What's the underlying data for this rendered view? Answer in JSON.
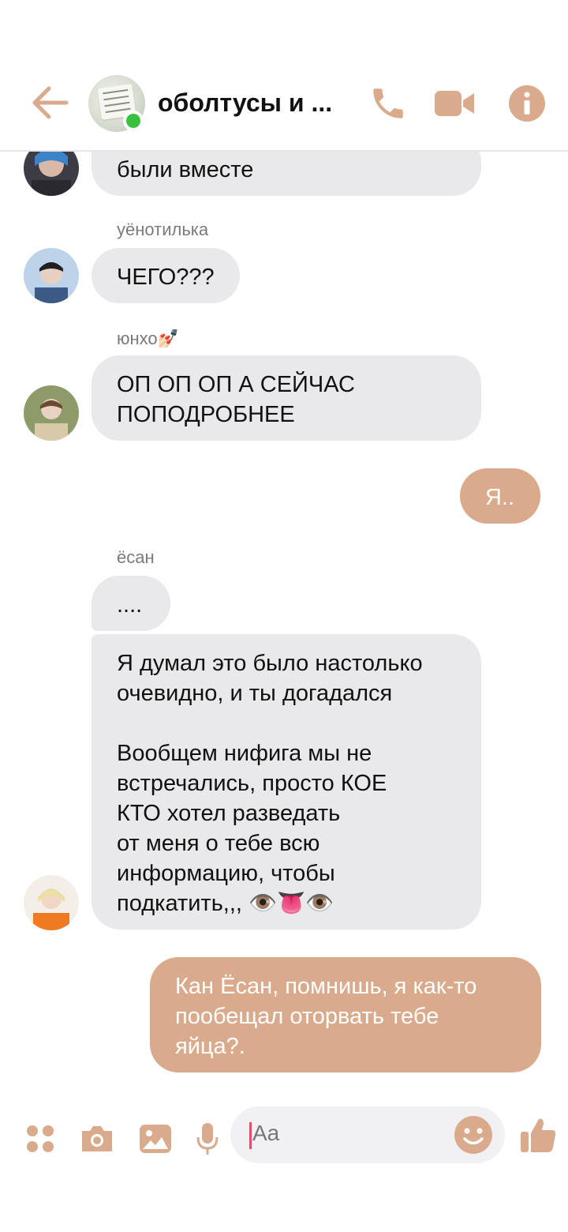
{
  "header": {
    "title": "оболтусы и ...",
    "accent": "#d9ab8c"
  },
  "messages": {
    "m1": {
      "text": "были вместе"
    },
    "m2": {
      "sender": "уёнотилька",
      "text": "ЧЕГО???"
    },
    "m3": {
      "sender": "юнхо💅🏻",
      "text": "ОП ОП ОП А СЕЙЧАС\nПОПОДРОБНЕЕ"
    },
    "m4": {
      "text": "Я.."
    },
    "m5": {
      "sender": "ёсан",
      "text": "...."
    },
    "m6": {
      "text": "Я думал это было настолько\nочевидно, и ты догадался\n\nВообщем нифига мы не\nвстречались, просто КОЕ\nКТО хотел разведать\nот меня о тебе всю\nинформацию, чтобы\nподкатить,,, 👁️👅👁️"
    },
    "m7": {
      "text": "Кан Ёсан, помнишь, я как-то\nпообещал оторвать тебе\nяйца?."
    }
  },
  "composer": {
    "placeholder": "Aa"
  },
  "icons": [
    "back-arrow-icon",
    "phone-icon",
    "video-icon",
    "info-icon",
    "apps-icon",
    "camera-icon",
    "gallery-icon",
    "microphone-icon",
    "emoji-icon",
    "thumbs-up-icon"
  ]
}
